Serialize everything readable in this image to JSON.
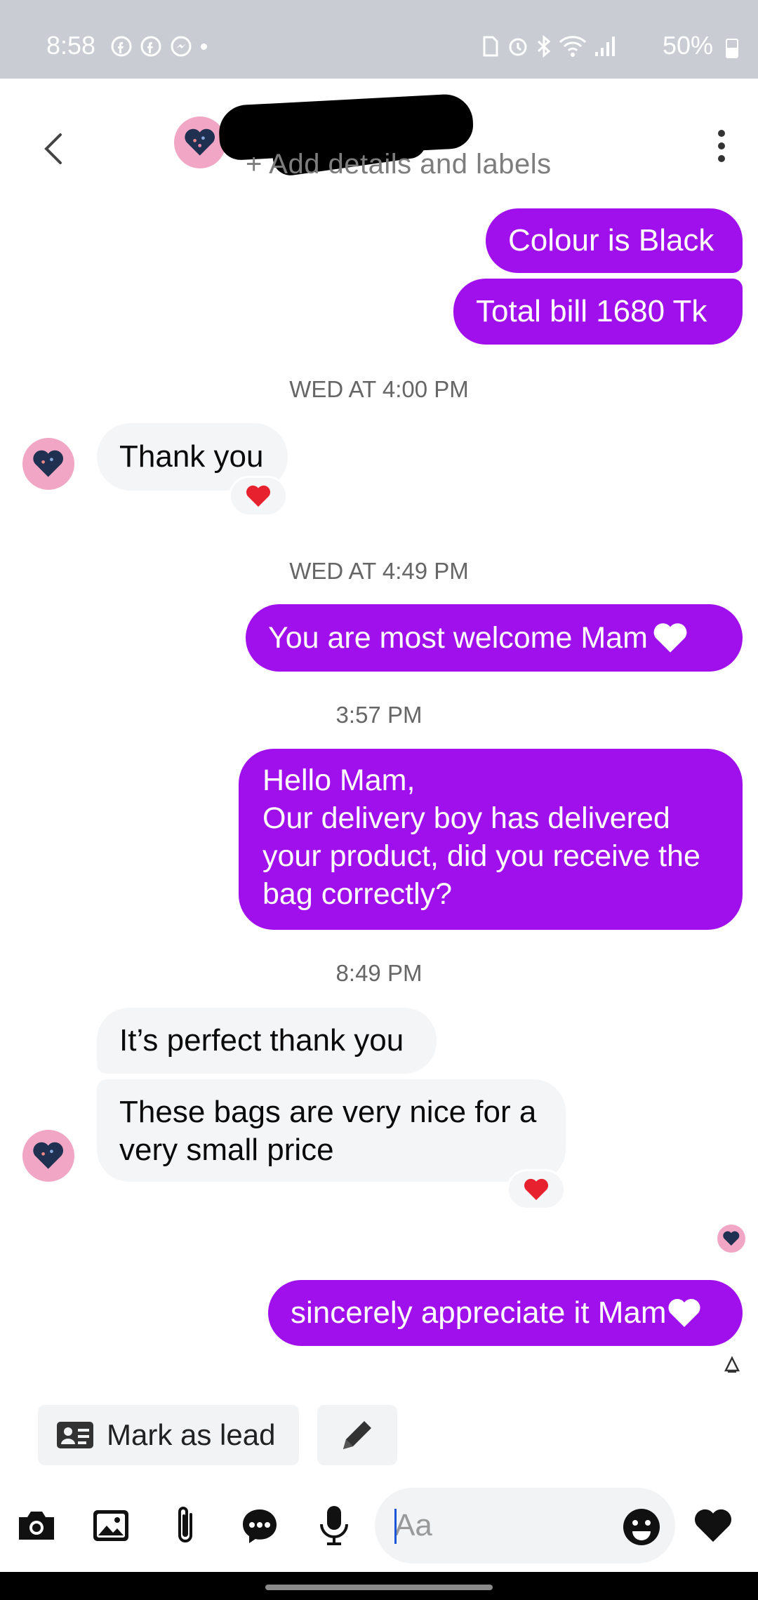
{
  "status_bar": {
    "time": "8:58",
    "battery": "50%"
  },
  "header": {
    "subtitle": "+ Add details and labels"
  },
  "messages": {
    "m1": "Colour is Black",
    "m2": "Total bill 1680 Tk",
    "ts1": "WED AT 4:00 PM",
    "m3": "Thank you",
    "ts2": "WED AT 4:49 PM",
    "m4": "You are most welcome Mam",
    "ts3": "3:57 PM",
    "m5": "Hello Mam,\nOur delivery boy has delivered your product, did you receive the bag correctly?",
    "ts4": "8:49 PM",
    "m6": "It’s perfect thank you",
    "m7": "These bags are very nice for a very small price",
    "m8": "sincerely appreciate it Mam"
  },
  "lead_bar": {
    "mark_as_lead": "Mark as lead"
  },
  "composer": {
    "placeholder": "Aa"
  },
  "colors": {
    "outgoing": "#a010ec",
    "incoming": "#f4f5f7",
    "reaction": "#e8212e"
  },
  "icons": [
    "back-icon",
    "more-icon",
    "camera-icon",
    "image-icon",
    "attach-icon",
    "chat-icon",
    "mic-icon",
    "emoji-icon",
    "like-heart-icon",
    "lead-card-icon",
    "pencil-icon"
  ]
}
